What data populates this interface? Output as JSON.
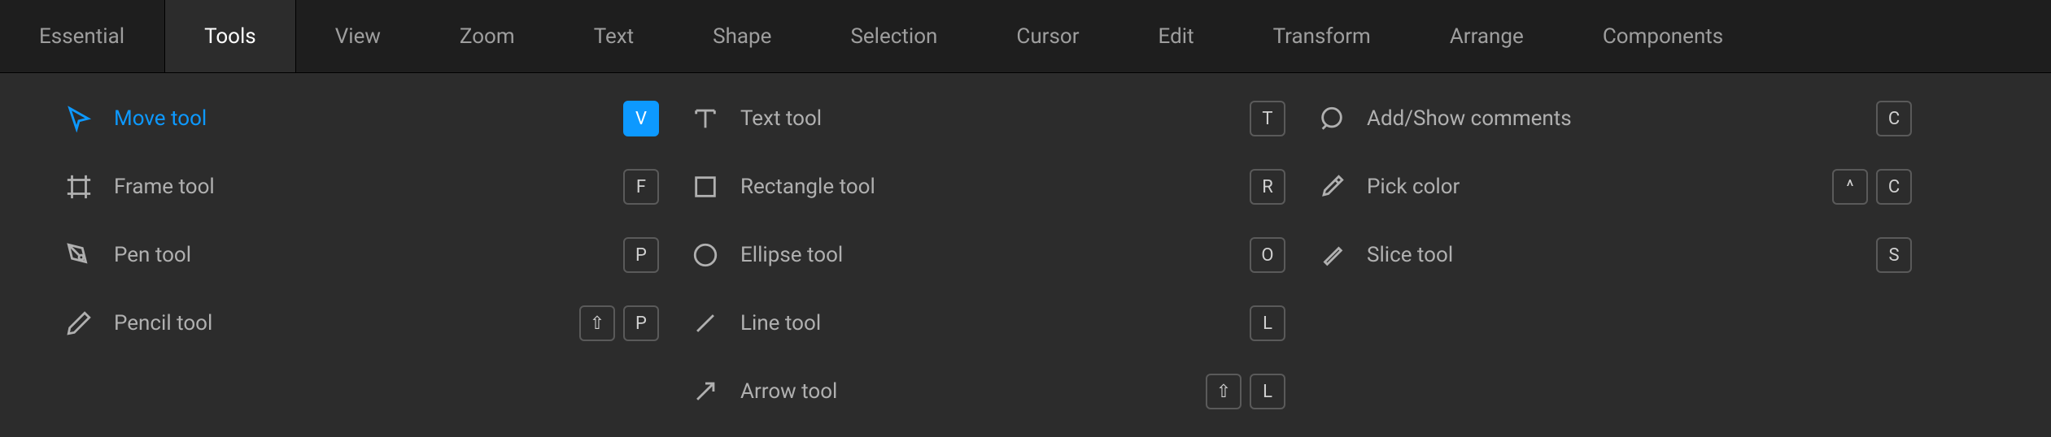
{
  "tabs": [
    {
      "label": "Essential",
      "active": false
    },
    {
      "label": "Tools",
      "active": true
    },
    {
      "label": "View",
      "active": false
    },
    {
      "label": "Zoom",
      "active": false
    },
    {
      "label": "Text",
      "active": false
    },
    {
      "label": "Shape",
      "active": false
    },
    {
      "label": "Selection",
      "active": false
    },
    {
      "label": "Cursor",
      "active": false
    },
    {
      "label": "Edit",
      "active": false
    },
    {
      "label": "Transform",
      "active": false
    },
    {
      "label": "Arrange",
      "active": false
    },
    {
      "label": "Components",
      "active": false
    }
  ],
  "columns": [
    [
      {
        "icon": "move",
        "label": "Move tool",
        "keys": [
          "V"
        ],
        "selected": true,
        "key_active": true
      },
      {
        "icon": "frame",
        "label": "Frame tool",
        "keys": [
          "F"
        ]
      },
      {
        "icon": "pen",
        "label": "Pen tool",
        "keys": [
          "P"
        ]
      },
      {
        "icon": "pencil",
        "label": "Pencil tool",
        "keys": [
          "⇧",
          "P"
        ]
      }
    ],
    [
      {
        "icon": "text",
        "label": "Text tool",
        "keys": [
          "T"
        ]
      },
      {
        "icon": "rectangle",
        "label": "Rectangle tool",
        "keys": [
          "R"
        ]
      },
      {
        "icon": "ellipse",
        "label": "Ellipse tool",
        "keys": [
          "O"
        ]
      },
      {
        "icon": "line",
        "label": "Line tool",
        "keys": [
          "L"
        ]
      },
      {
        "icon": "arrow",
        "label": "Arrow tool",
        "keys": [
          "⇧",
          "L"
        ]
      }
    ],
    [
      {
        "icon": "comment",
        "label": "Add/Show comments",
        "keys": [
          "C"
        ]
      },
      {
        "icon": "eyedropper",
        "label": "Pick color",
        "keys": [
          "^",
          "C"
        ]
      },
      {
        "icon": "slice",
        "label": "Slice tool",
        "keys": [
          "S"
        ]
      }
    ]
  ]
}
